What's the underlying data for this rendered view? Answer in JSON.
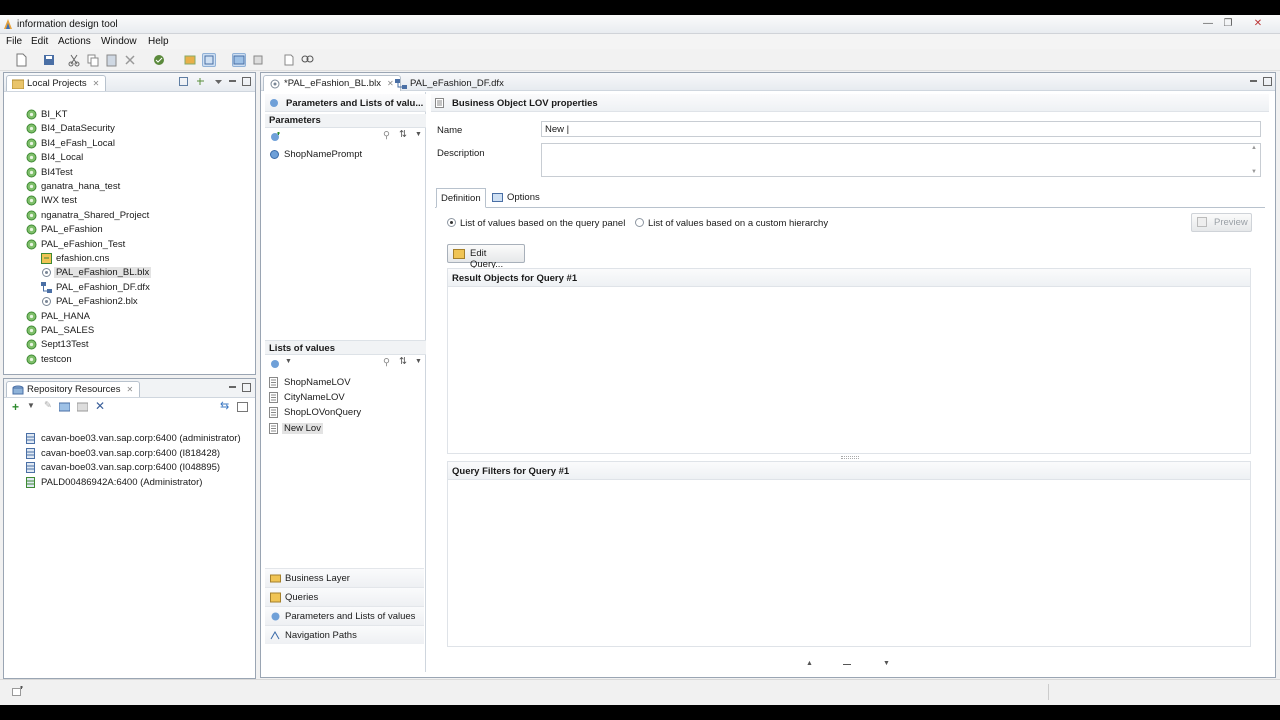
{
  "window": {
    "title": "information design tool"
  },
  "menu": [
    "File",
    "Edit",
    "Actions",
    "Window",
    "Help"
  ],
  "local_projects": {
    "tab_label": "Local Projects",
    "items": [
      {
        "label": "BI_KT",
        "icon": "project-icon",
        "indent": 0
      },
      {
        "label": "BI4_DataSecurity",
        "icon": "project-icon",
        "indent": 0
      },
      {
        "label": "BI4_eFash_Local",
        "icon": "project-icon",
        "indent": 0
      },
      {
        "label": "BI4_Local",
        "icon": "project-icon",
        "indent": 0
      },
      {
        "label": "BI4Test",
        "icon": "project-icon",
        "indent": 0
      },
      {
        "label": "ganatra_hana_test",
        "icon": "project-icon",
        "indent": 0
      },
      {
        "label": "IWX test",
        "icon": "project-icon",
        "indent": 0
      },
      {
        "label": "nganatra_Shared_Project",
        "icon": "project-icon",
        "indent": 0
      },
      {
        "label": "PAL_eFashion",
        "icon": "project-icon",
        "indent": 0
      },
      {
        "label": "PAL_eFashion_Test",
        "icon": "project-icon",
        "indent": 0
      },
      {
        "label": "efashion.cns",
        "icon": "connection-icon",
        "indent": 1
      },
      {
        "label": "PAL_eFashion_BL.blx",
        "icon": "business-layer-icon",
        "indent": 1,
        "selected": true
      },
      {
        "label": "PAL_eFashion_DF.dfx",
        "icon": "data-foundation-icon",
        "indent": 1
      },
      {
        "label": "PAL_eFashion2.blx",
        "icon": "business-layer-icon",
        "indent": 1
      },
      {
        "label": "PAL_HANA",
        "icon": "project-icon",
        "indent": 0
      },
      {
        "label": "PAL_SALES",
        "icon": "project-icon",
        "indent": 0
      },
      {
        "label": "Sept13Test",
        "icon": "project-icon",
        "indent": 0
      },
      {
        "label": "testcon",
        "icon": "project-icon",
        "indent": 0
      }
    ]
  },
  "repository": {
    "tab_label": "Repository Resources",
    "items": [
      "cavan-boe03.van.sap.corp:6400 (administrator)",
      "cavan-boe03.van.sap.corp:6400 (I818428)",
      "cavan-boe03.van.sap.corp:6400 (I048895)",
      "PALD00486942A:6400 (Administrator)"
    ]
  },
  "editor_tabs": [
    {
      "label": "*PAL_eFashion_BL.blx",
      "active": true
    },
    {
      "label": "PAL_eFashion_DF.dfx",
      "active": false
    }
  ],
  "left_pane": {
    "header": "Parameters and Lists of valu...",
    "parameters_title": "Parameters",
    "parameters": [
      "ShopNamePrompt"
    ],
    "lov_title": "Lists of values",
    "lovs": [
      "ShopNameLOV",
      "CityNameLOV",
      "ShopLOVonQuery",
      "New Lov"
    ],
    "nav": [
      "Business Layer",
      "Queries",
      "Parameters and Lists of values",
      "Navigation Paths"
    ]
  },
  "properties": {
    "title": "Business Object LOV properties",
    "name_label": "Name",
    "name_value": "New |",
    "description_label": "Description",
    "tabs": [
      "Definition",
      "Options"
    ],
    "radio_query": "List of values based on the query panel",
    "radio_hierarchy": "List of values based on a custom hierarchy",
    "preview_label": "Preview",
    "edit_query_label": "Edit Query...",
    "result_objects_title": "Result Objects for Query #1",
    "query_filters_title": "Query Filters for Query #1"
  }
}
